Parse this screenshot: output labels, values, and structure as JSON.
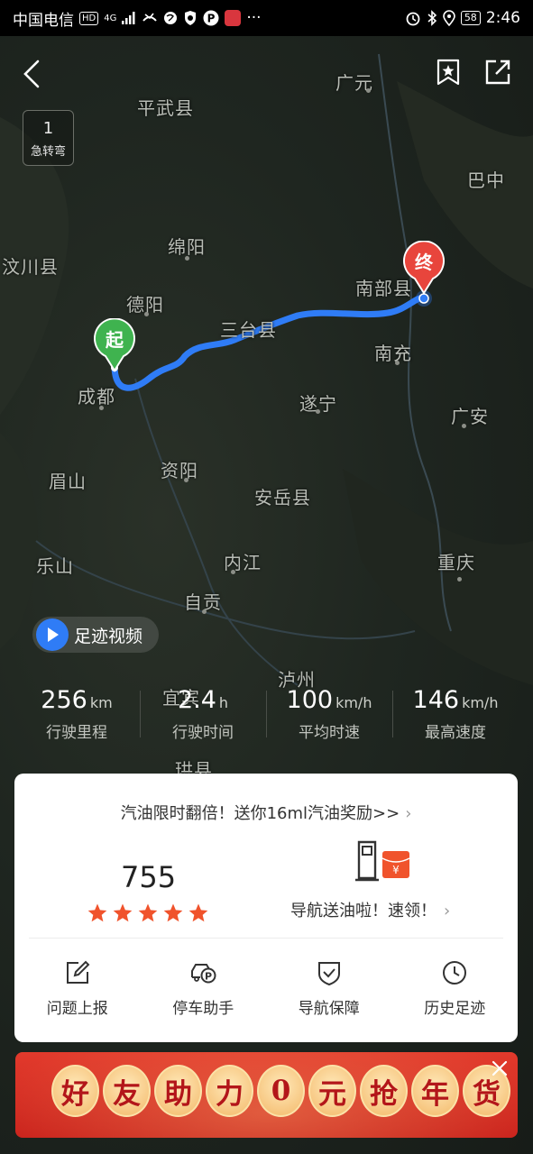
{
  "status_bar": {
    "carrier": "中国电信",
    "hd": "HD",
    "net": "4G",
    "battery": "58",
    "time": "2:46"
  },
  "map": {
    "turn_box": {
      "count": "1",
      "label": "急转弯"
    },
    "cities": [
      {
        "id": "guangyuan",
        "name": "广元"
      },
      {
        "id": "pingwu",
        "name": "平武县"
      },
      {
        "id": "bazhong",
        "name": "巴中"
      },
      {
        "id": "mianyang",
        "name": "绵阳"
      },
      {
        "id": "wenchuan",
        "name": "汶川县"
      },
      {
        "id": "deyang",
        "name": "德阳"
      },
      {
        "id": "nanbu",
        "name": "南部县"
      },
      {
        "id": "santai",
        "name": "三台县"
      },
      {
        "id": "nanchong",
        "name": "南充"
      },
      {
        "id": "chengdu",
        "name": "成都"
      },
      {
        "id": "suining",
        "name": "遂宁"
      },
      {
        "id": "guangan",
        "name": "广安"
      },
      {
        "id": "meishan",
        "name": "眉山"
      },
      {
        "id": "ziyang",
        "name": "资阳"
      },
      {
        "id": "anyue",
        "name": "安岳县"
      },
      {
        "id": "leshan",
        "name": "乐山"
      },
      {
        "id": "neijiang",
        "name": "内江"
      },
      {
        "id": "chongqing",
        "name": "重庆"
      },
      {
        "id": "zigong",
        "name": "自贡"
      },
      {
        "id": "luzhou",
        "name": "泸州"
      },
      {
        "id": "yibin",
        "name": "宜宾"
      },
      {
        "id": "gongxian",
        "name": "珙县"
      }
    ],
    "start_label": "起",
    "end_label": "终",
    "video_button": "足迹视频"
  },
  "stats": [
    {
      "value": "256",
      "unit": "km",
      "label": "行驶里程"
    },
    {
      "value": "2.4",
      "unit": "h",
      "label": "行驶时间"
    },
    {
      "value": "100",
      "unit": "km/h",
      "label": "平均时速"
    },
    {
      "value": "146",
      "unit": "km/h",
      "label": "最高速度"
    }
  ],
  "card": {
    "promo": "汽油限时翻倍！送你16ml汽油奖励>>",
    "score": "755",
    "star_count": 5,
    "gift_text": "导航送油啦！速领！",
    "actions": [
      {
        "label": "问题上报",
        "icon": "edit-icon"
      },
      {
        "label": "停车助手",
        "icon": "parking-car-icon"
      },
      {
        "label": "导航保障",
        "icon": "shield-check-icon"
      },
      {
        "label": "历史足迹",
        "icon": "clock-icon"
      }
    ]
  },
  "banner": {
    "chars": [
      "好",
      "友",
      "助",
      "力",
      "0",
      "元",
      "抢",
      "年",
      "货"
    ]
  },
  "colors": {
    "route": "#2f7cf6",
    "start_pin": "#3fb34f",
    "end_pin": "#e8453c",
    "star": "#f0532c",
    "banner": "#d22a22"
  }
}
